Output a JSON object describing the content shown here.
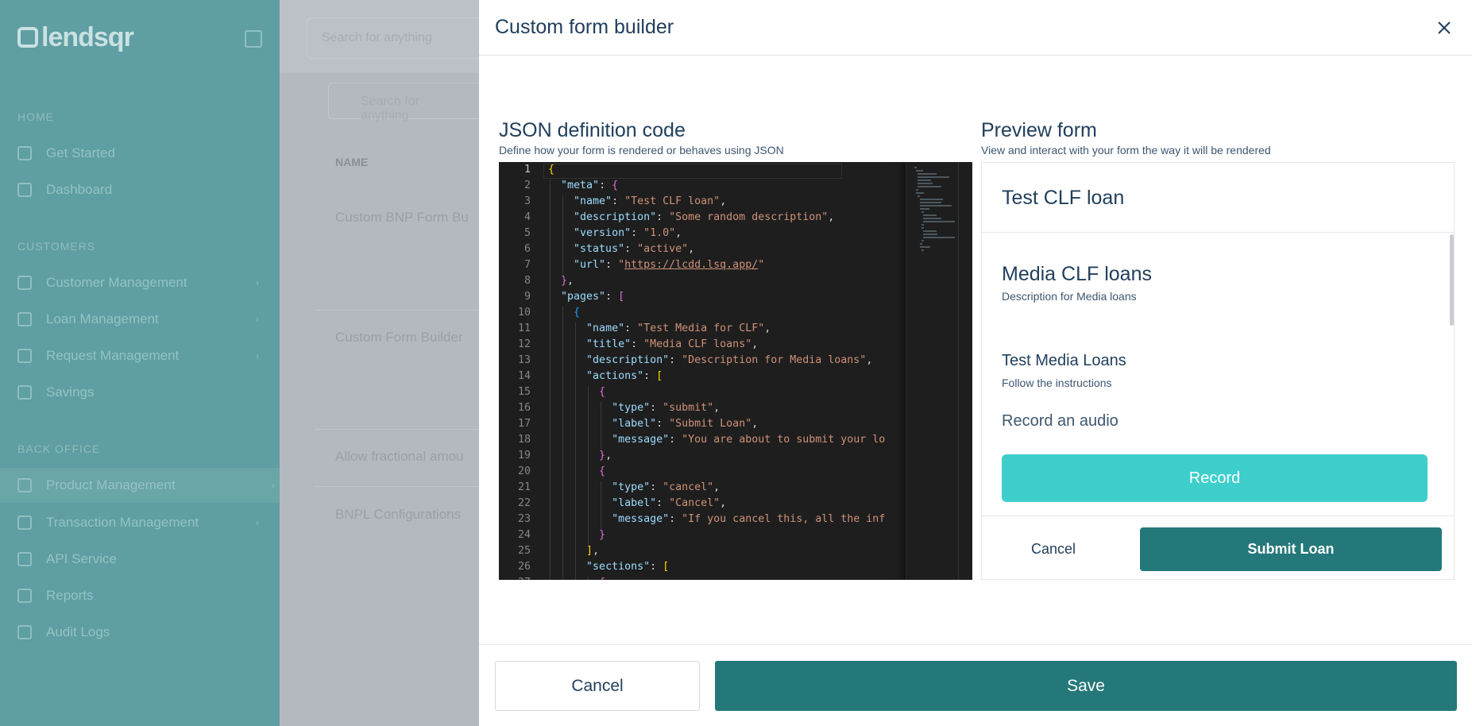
{
  "background": {
    "brand": "lendsqr",
    "top_search_placeholder": "Search for anything",
    "table_search_placeholder": "Search for anything",
    "nav": {
      "sections": [
        {
          "title": "HOME",
          "items": [
            {
              "label": "Get Started"
            },
            {
              "label": "Dashboard"
            }
          ]
        },
        {
          "title": "CUSTOMERS",
          "items": [
            {
              "label": "Customer Management"
            },
            {
              "label": "Loan Management"
            },
            {
              "label": "Request Management"
            },
            {
              "label": "Savings"
            }
          ]
        },
        {
          "title": "BACK OFFICE",
          "items": [
            {
              "label": "Product Management"
            },
            {
              "label": "Transaction Management"
            },
            {
              "label": "API Service"
            },
            {
              "label": "Reports"
            },
            {
              "label": "Audit Logs"
            }
          ]
        }
      ],
      "active_item": "Product Management"
    },
    "table": {
      "header_name": "NAME",
      "rows": [
        "Custom BNP Form Bu",
        "Custom Form Builder",
        "Allow fractional amou",
        "BNPL Configurations"
      ]
    }
  },
  "modal": {
    "title": "Custom form builder",
    "json_panel": {
      "title": "JSON definition code",
      "subtitle": "Define how your form is rendered or behaves using JSON"
    },
    "preview_panel": {
      "title": "Preview form",
      "subtitle": "View and interact with your form the way it will be rendered",
      "form_title": "Test CLF loan",
      "page_title": "Media CLF loans",
      "page_description": "Description for Media loans",
      "section_title": "Test Media Loans",
      "section_description": "Follow the instructions",
      "field_label": "Record an audio",
      "record_button": "Record",
      "cancel_button": "Cancel",
      "submit_button": "Submit Loan"
    },
    "footer": {
      "cancel_label": "Cancel",
      "save_label": "Save"
    }
  },
  "editor": {
    "lines": [
      "{",
      "  \"meta\": {",
      "    \"name\": \"Test CLF loan\",",
      "    \"description\": \"Some random description\",",
      "    \"version\": \"1.0\",",
      "    \"status\": \"active\",",
      "    \"url\": \"https://lcdd.lsq.app/\"",
      "  },",
      "  \"pages\": [",
      "    {",
      "      \"name\": \"Test Media for CLF\",",
      "      \"title\": \"Media CLF loans\",",
      "      \"description\": \"Description for Media loans\",",
      "      \"actions\": [",
      "        {",
      "          \"type\": \"submit\",",
      "          \"label\": \"Submit Loan\",",
      "          \"message\": \"You are about to submit your lo",
      "        },",
      "        {",
      "          \"type\": \"cancel\",",
      "          \"label\": \"Cancel\",",
      "          \"message\": \"If you cancel this, all the inf",
      "        }",
      "      ],",
      "      \"sections\": [",
      "        {"
    ]
  },
  "colors": {
    "primary": "#25787a",
    "accent": "#3ecfcd",
    "heading": "#213f5b",
    "editor_bg": "#1e1e1e"
  }
}
